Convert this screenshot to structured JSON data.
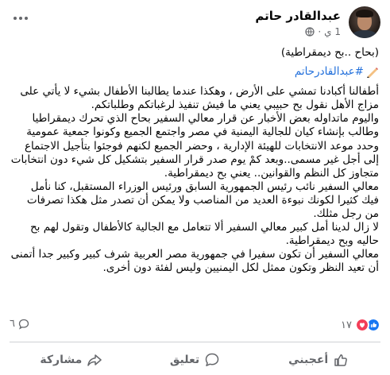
{
  "post": {
    "author": "عبدالقادر حاتم",
    "time": "1 ي",
    "privacy_icon": "globe-icon",
    "more_icon": "more-icon",
    "title": "(بحاح ..بح ديمقراطية)",
    "hashtag": "#عبدالقادرحاتم",
    "paragraphs": [
      "أطفالنا أكبادنا تمشي على الأرض ، وهكذا عندما يطالبنا الأطفال بشيء لا يأتي على مزاج الأهل نقول بح حبيبي يعني ما فيش تنفيذ لرغباتكم وطلباتكم.",
      "واليوم ماتداوله بعض الأخبار عن قرار معالي السفير بحاح الذي تحرك ديمقراطيا وطالب بإنشاء كيان للجالية اليمنية في مصر واجتمع الجميع وكونوا جمعية عمومية وحدد موعد الانتخابات للهيئة الإدارية ، وحضر الجميع لكنهم فوجئوا بتأجيل الاجتماع إلى أجل غير مسمى..وبعد كمْ يوم صدر قرار السفير بتشكيل كل شيء دون انتخابات متجاوز كل النظم والقوانين.. يعني بح ديمقراطية.",
      "معالي السفير نائب رئيس الجمهورية السابق ورئيس الوزراء المستقبل، كنا نأمل فيك كثيرا لكونك نبوءة العديد من المناصب ولا يمكن أن تصدر مثل هكذا تصرفات من رجل مثلك.",
      "لا زال لدينا أمل كبير معالي السفير ألا تتعامل مع الجالية كالأطفال وتقول لهم بح حاليه وبح ديمقراطية.",
      "معالي السفير أن تكون سفيرا في جمهورية مصر العربية شرف كبير وكبير جدا أتمنى أن تعيد النظر وتكون ممثل لكل اليمنيين وليس لفئة دون أخرى."
    ]
  },
  "reactions": {
    "count": "١٧",
    "comments_count": "٦",
    "like_color": "#1877f2",
    "love_color": "#f33e58"
  },
  "actions": {
    "like_label": "أعجبني",
    "comment_label": "تعليق",
    "share_label": "مشاركة"
  }
}
